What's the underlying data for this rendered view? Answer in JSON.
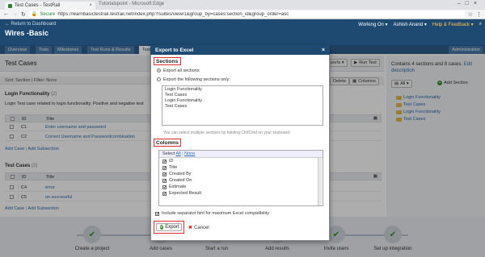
{
  "browser": {
    "tab_title": "Test Cases - TestRail",
    "tab_rest": "Tutorialspoint - Microsoft Edge",
    "secure_label": "Secure",
    "url": "https://learnbasictestrail.testrail.net/index.php?/suites/view/1&group_by=cases:section_id&group_order=asc"
  },
  "header": {
    "return_link": "← Return to Dashboard",
    "project_name": "Wires -Basic",
    "working_on": "Working On ▾",
    "user": "Ashish Anand ▾",
    "help": "Help & Feedback ▾"
  },
  "nav": {
    "tabs": [
      "Overview",
      "Todo",
      "Milestones",
      "Test Runs & Results",
      "Test"
    ],
    "admin": "Administration"
  },
  "main": {
    "title": "Test Cases",
    "export_btn": "ports ▾",
    "run_test_btn": "Run Test",
    "delete_btn": "Delete",
    "columns_btn": "Columns",
    "sort_text": "Sort: Section | Filter: None",
    "sections": [
      {
        "title": "Login Functionality",
        "count": "(2)",
        "desc": "Login Test case related to login functionality. Positive and negative test",
        "col_id": "ID",
        "col_title": "Title",
        "rows": [
          {
            "id": "C1",
            "title": "Enter username and password"
          },
          {
            "id": "C2",
            "title": "Correct Username and Passwordcombination"
          }
        ],
        "add_case": "Add Case",
        "add_subsection": "Add Subsection"
      },
      {
        "title": "Test Cases",
        "count": "(2)",
        "col_id": "ID",
        "col_title": "Title",
        "rows": [
          {
            "id": "C4",
            "title": "error"
          },
          {
            "id": "C5",
            "title": "on successful"
          }
        ],
        "add_case": "Add Case",
        "add_subsection": "Add Subsection"
      }
    ]
  },
  "right": {
    "info_pre": "Contains 4 sections and 8 cases.",
    "edit": "Edit",
    "description": "description",
    "all_btn": "All ▾",
    "add_section": "Add Section",
    "tree": [
      "Login Functionality",
      "Test Cases",
      "Login Functionality",
      "Test Cases"
    ]
  },
  "dialog": {
    "title": "Export to Excel",
    "close": "×",
    "sections_label": "Sections",
    "opt_all": "Export all sections",
    "opt_following": "Export the following sections only:",
    "section_list": [
      "Login Functionality",
      "Test Cases",
      "Login Functionality",
      "Test Cases"
    ],
    "hint": "You can select multiple sections by holding Ctrl/Cmd on your keyboard.",
    "columns_label": "Columns",
    "select_all": "All",
    "select_none": "None",
    "select_prefix": "Select",
    "columns": [
      "ID",
      "Title",
      "Created By",
      "Created On",
      "Estimate",
      "Expected Result"
    ],
    "separator_hint": "Include separator hint for maximum Excel compatibility",
    "export_btn": "Export",
    "cancel_btn": "Cancel"
  },
  "steps": [
    "Create a project",
    "Add cases",
    "Start a run",
    "Add results",
    "Invite users",
    "Set up integration"
  ]
}
